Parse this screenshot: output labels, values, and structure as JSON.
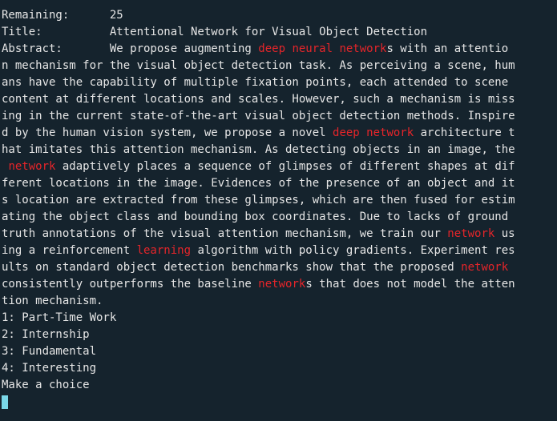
{
  "colors": {
    "background": "#15232d",
    "text": "#e6e6e6",
    "highlight": "#e5252a",
    "cursor": "#7ad7e7"
  },
  "lines": [
    [
      {
        "t": "Remaining:      25"
      }
    ],
    [
      {
        "t": "Title:          Attentional Network for Visual Object Detection"
      }
    ],
    [
      {
        "t": "Abstract:       We propose augmenting "
      },
      {
        "t": "deep neural network",
        "hl": true
      },
      {
        "t": "s with an attentio"
      }
    ],
    [
      {
        "t": "n mechanism for the visual object detection task. As perceiving a scene, hum"
      }
    ],
    [
      {
        "t": "ans have the capability of multiple fixation points, each attended to scene"
      }
    ],
    [
      {
        "t": "content at different locations and scales. However, such a mechanism is miss"
      }
    ],
    [
      {
        "t": "ing in the current state-of-the-art visual object detection methods. Inspire"
      }
    ],
    [
      {
        "t": "d by the human vision system, we propose a novel "
      },
      {
        "t": "deep network",
        "hl": true
      },
      {
        "t": " architecture t"
      }
    ],
    [
      {
        "t": "hat imitates this attention mechanism. As detecting objects in an image, the"
      }
    ],
    [
      {
        "t": " "
      },
      {
        "t": "network",
        "hl": true
      },
      {
        "t": " adaptively places a sequence of glimpses of different shapes at dif"
      }
    ],
    [
      {
        "t": "ferent locations in the image. Evidences of the presence of an object and it"
      }
    ],
    [
      {
        "t": "s location are extracted from these glimpses, which are then fused for estim"
      }
    ],
    [
      {
        "t": "ating the object class and bounding box coordinates. Due to lacks of ground"
      }
    ],
    [
      {
        "t": "truth annotations of the visual attention mechanism, we train our "
      },
      {
        "t": "network",
        "hl": true
      },
      {
        "t": " us"
      }
    ],
    [
      {
        "t": "ing a reinforcement "
      },
      {
        "t": "learning",
        "hl": true
      },
      {
        "t": " algorithm with policy gradients. Experiment res"
      }
    ],
    [
      {
        "t": "ults on standard object detection benchmarks show that the proposed "
      },
      {
        "t": "network",
        "hl": true
      }
    ],
    [
      {
        "t": "consistently outperforms the baseline "
      },
      {
        "t": "network",
        "hl": true
      },
      {
        "t": "s that does not model the atten"
      }
    ],
    [
      {
        "t": "tion mechanism."
      }
    ],
    [
      {
        "t": "1: Part-Time Work"
      }
    ],
    [
      {
        "t": "2: Internship"
      }
    ],
    [
      {
        "t": "3: Fundamental"
      }
    ],
    [
      {
        "t": "4: Interesting"
      }
    ],
    [
      {
        "t": "Make a choice"
      }
    ]
  ]
}
